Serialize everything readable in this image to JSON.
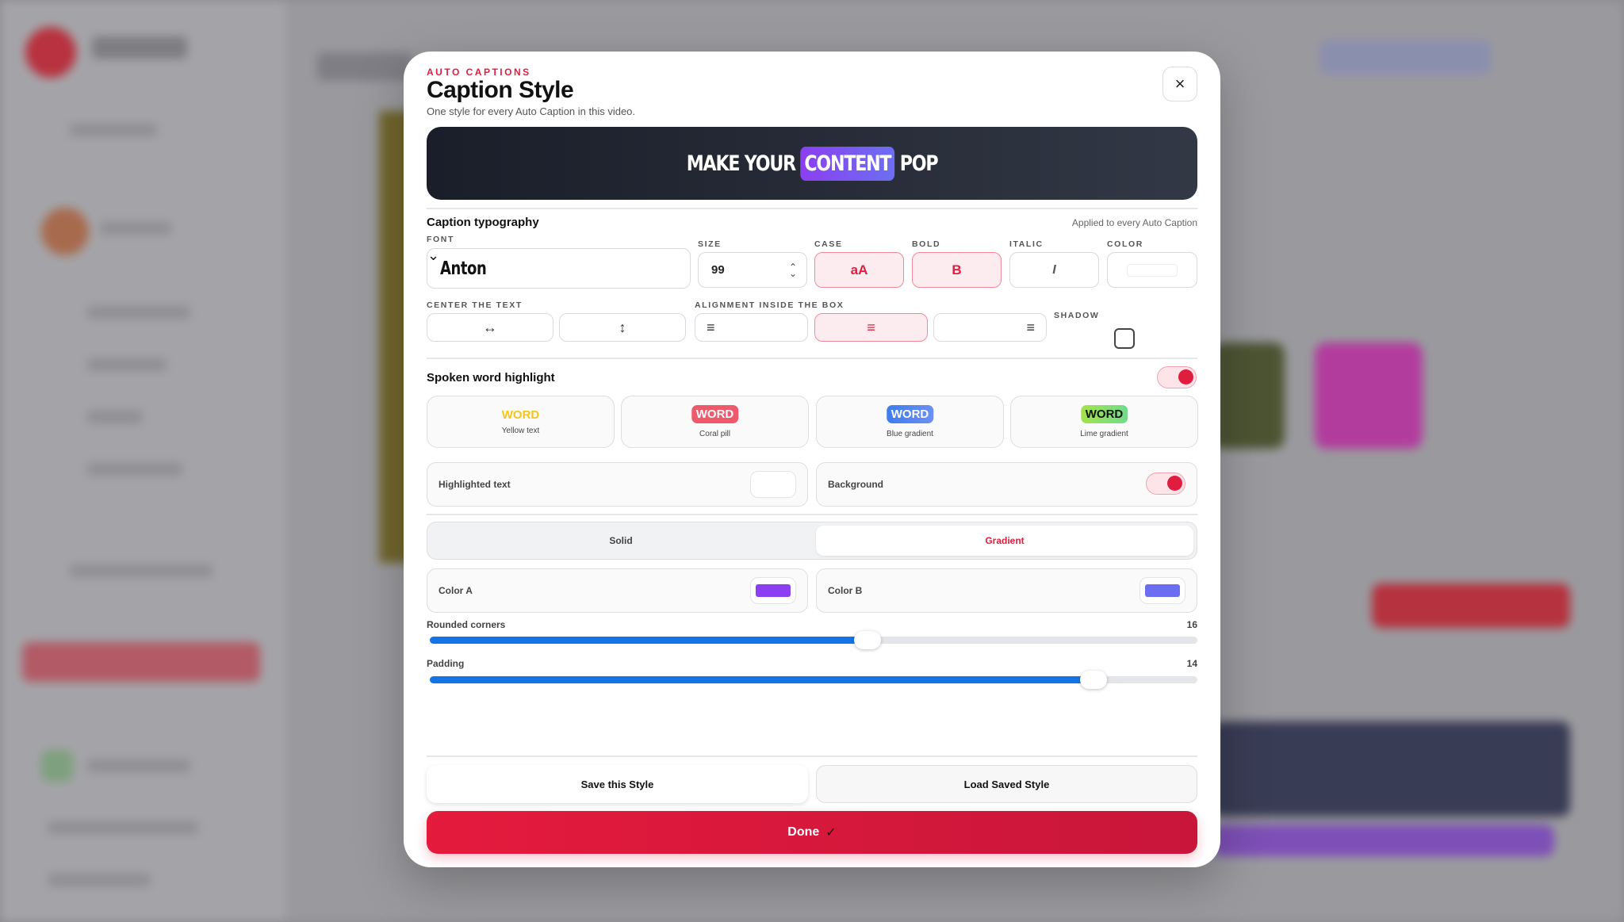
{
  "modal": {
    "eyebrow": "AUTO CAPTIONS",
    "title": "Caption Style",
    "subtitle": "One style for every Auto Caption in this video.",
    "close_icon": "×"
  },
  "preview": {
    "before": "MAKE YOUR",
    "highlight": "CONTENT",
    "after": "POP"
  },
  "typography": {
    "title": "Caption typography",
    "note": "Applied to every Auto Caption",
    "font_label": "FONT",
    "font_value": "Anton",
    "size_label": "SIZE",
    "size_value": "99",
    "case_label": "CASE",
    "case_value": "aA",
    "bold_label": "BOLD",
    "bold_value": "B",
    "italic_label": "ITALIC",
    "italic_value": "I",
    "color_label": "COLOR",
    "color_value": "#ffffff",
    "center_label": "CENTER THE TEXT",
    "align_label": "ALIGNMENT INSIDE THE BOX",
    "shadow_label": "SHADOW",
    "center_horizontal_icon": "↔",
    "center_vertical_icon": "↕",
    "align_left_icon": "≡",
    "align_center_icon": "≡",
    "align_right_icon": "≡",
    "shadow_checked": false
  },
  "highlight": {
    "title": "Spoken word highlight",
    "enabled": true,
    "presets": [
      {
        "chip": "WORD",
        "label": "Yellow text"
      },
      {
        "chip": "WORD",
        "label": "Coral pill"
      },
      {
        "chip": "WORD",
        "label": "Blue gradient"
      },
      {
        "chip": "WORD",
        "label": "Lime gradient"
      }
    ],
    "highlighted_text_label": "Highlighted text",
    "background_label": "Background",
    "background_enabled": true
  },
  "fill": {
    "solid_label": "Solid",
    "gradient_label": "Gradient",
    "selected": "Gradient",
    "color_a_label": "Color A",
    "color_a": "#8b3ff0",
    "color_b_label": "Color B",
    "color_b": "#6c6ef2"
  },
  "sliders": {
    "corners_label": "Rounded corners",
    "corners_value": "16",
    "corners_fraction": 0.57,
    "padding_label": "Padding",
    "padding_value": "14",
    "padding_fraction": 0.865
  },
  "actions": {
    "save_label": "Save this Style",
    "load_label": "Load Saved Style",
    "done_label": "Done",
    "done_icon": "✓"
  },
  "colors": {
    "accent": "#e11d3f",
    "slider": "#1474e6"
  }
}
